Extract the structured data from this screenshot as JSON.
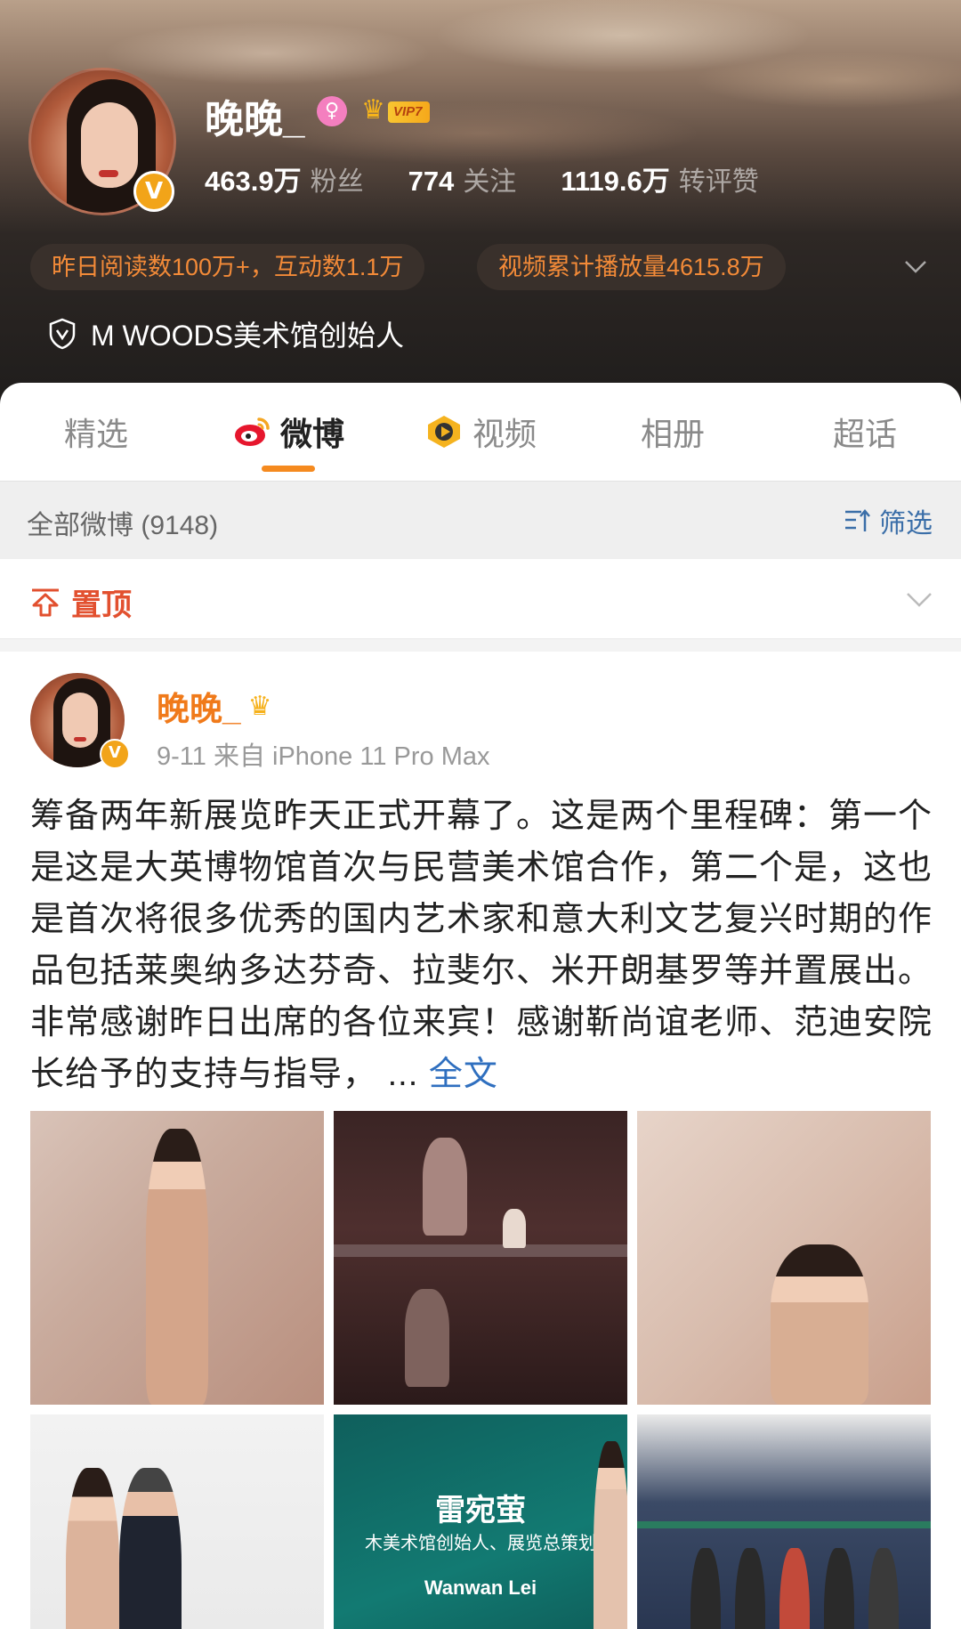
{
  "profile": {
    "username": "晚晚_",
    "gender_icon": "female-symbol",
    "vip_label": "VIP7",
    "stats": [
      {
        "value": "463.9万",
        "label": "粉丝"
      },
      {
        "value": "774",
        "label": "关注"
      },
      {
        "value": "1119.6万",
        "label": "转评赞"
      }
    ],
    "pill_reads": "昨日阅读数100万+，互动数1.1万",
    "pill_video": "视频累计播放量4615.8万",
    "verification": "M WOODS美术馆创始人"
  },
  "tabs": [
    {
      "label": "精选",
      "active": false
    },
    {
      "label": "微博",
      "active": true
    },
    {
      "label": "视频",
      "active": false
    },
    {
      "label": "相册",
      "active": false
    },
    {
      "label": "超话",
      "active": false
    }
  ],
  "filter_bar": {
    "all_label": "全部微博 (9148)",
    "filter_label": "筛选"
  },
  "pinned": {
    "label": "置顶"
  },
  "post": {
    "author": "晚晚_",
    "meta": "9-11  来自 iPhone 11 Pro Max",
    "text": "筹备两年新展览昨天正式开幕了。这是两个里程碑：第一个是这是大英博物馆首次与民营美术馆合作，第二个是，这也是首次将很多优秀的国内艺术家和意大利文艺复兴时期的作品包括莱奥纳多达芬奇、拉斐尔、米开朗基罗等并置展出。非常感谢昨日出席的各位来宾！感谢靳尚谊老师、范迪安院长给予的支持与指导，",
    "ellipsis": " ... ",
    "more_label": "全文",
    "photo5_title": "雷宛萤",
    "photo5_sub": "木美术馆创始人、展览总策划",
    "photo5_en": "Wanwan Lei"
  },
  "colors": {
    "accent": "#f58a1f",
    "link": "#2f6fbf",
    "pinned": "#e2502f"
  }
}
